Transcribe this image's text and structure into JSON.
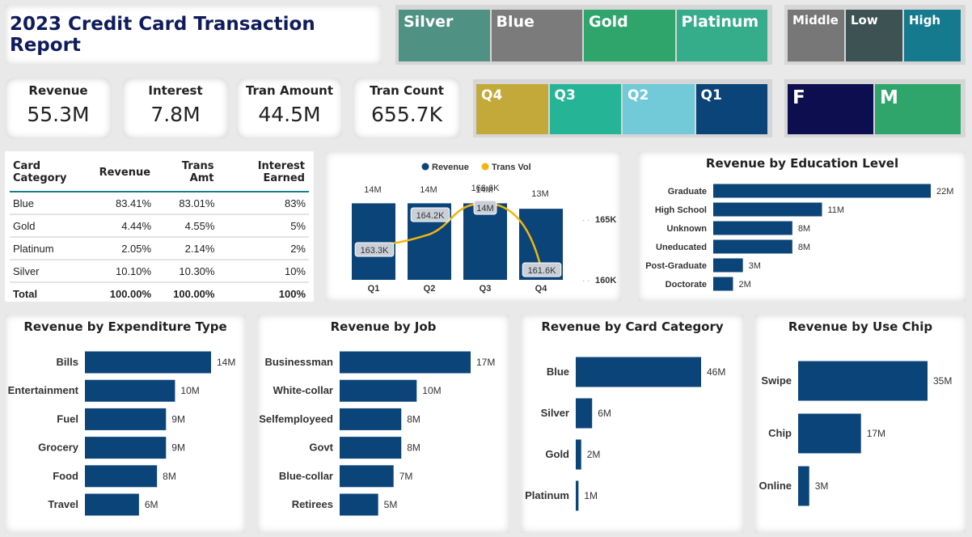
{
  "title": "2023 Credit Card Transaction Report",
  "slicers": {
    "card": [
      {
        "label": "Silver",
        "color": "#4f9283"
      },
      {
        "label": "Blue",
        "color": "#7b7b7b"
      },
      {
        "label": "Gold",
        "color": "#2fa56c"
      },
      {
        "label": "Platinum",
        "color": "#35ad8a"
      }
    ],
    "income": [
      {
        "label": "Middle",
        "color": "#777777"
      },
      {
        "label": "Low",
        "color": "#3d5252"
      },
      {
        "label": "High",
        "color": "#167a8e"
      }
    ],
    "quarter": [
      {
        "label": "Q4",
        "color": "#c2a93a"
      },
      {
        "label": "Q3",
        "color": "#26b496"
      },
      {
        "label": "Q2",
        "color": "#72c9d8"
      },
      {
        "label": "Q1",
        "color": "#0b4478"
      }
    ],
    "gender": [
      {
        "label": "F",
        "color": "#0c0e4f"
      },
      {
        "label": "M",
        "color": "#2fa56c"
      }
    ]
  },
  "kpis": [
    {
      "label": "Revenue",
      "value": "55.3M"
    },
    {
      "label": "Interest",
      "value": "7.8M"
    },
    {
      "label": "Tran Amount",
      "value": "44.5M"
    },
    {
      "label": "Tran Count",
      "value": "655.7K"
    }
  ],
  "table": {
    "headers": [
      "Card Category",
      "Revenue",
      "Trans Amt",
      "Interest Earned"
    ],
    "rows": [
      [
        "Blue",
        "83.41%",
        "83.01%",
        "83%"
      ],
      [
        "Gold",
        "4.44%",
        "4.55%",
        "5%"
      ],
      [
        "Platinum",
        "2.05%",
        "2.14%",
        "2%"
      ],
      [
        "Silver",
        "10.10%",
        "10.30%",
        "10%"
      ]
    ],
    "total": [
      "Total",
      "100.00%",
      "100.00%",
      "100%"
    ]
  },
  "colors": {
    "bar": "#0b4478",
    "line": "#f2b50f"
  },
  "chart_data": [
    {
      "type": "bar",
      "id": "combo",
      "legend": [
        "Revenue",
        "Trans Vol"
      ],
      "categories": [
        "Q1",
        "Q2",
        "Q3",
        "Q4"
      ],
      "series": [
        {
          "name": "Revenue",
          "values": [
            14,
            14,
            14,
            13
          ],
          "labels": [
            "14M",
            "14M",
            "14M",
            "13M"
          ]
        },
        {
          "name": "Trans Vol",
          "values": [
            163.3,
            164.2,
            166.6,
            161.6
          ],
          "labels": [
            "163.3K",
            "164.2K",
            "166.6K",
            "161.6K"
          ]
        }
      ],
      "y2_ticks": [
        "165K",
        "160K"
      ]
    },
    {
      "type": "bar",
      "id": "education",
      "title": "Revenue by Education Level",
      "categories": [
        "Graduate",
        "High School",
        "Unknown",
        "Uneducated",
        "Post-Graduate",
        "Doctorate"
      ],
      "values": [
        22,
        11,
        8,
        8,
        3,
        2
      ],
      "labels": [
        "22M",
        "11M",
        "8M",
        "8M",
        "3M",
        "2M"
      ]
    },
    {
      "type": "bar",
      "id": "expenditure",
      "title": "Revenue by Expenditure Type",
      "categories": [
        "Bills",
        "Entertainment",
        "Fuel",
        "Grocery",
        "Food",
        "Travel"
      ],
      "values": [
        14,
        10,
        9,
        9,
        8,
        6
      ],
      "labels": [
        "14M",
        "10M",
        "9M",
        "9M",
        "8M",
        "6M"
      ]
    },
    {
      "type": "bar",
      "id": "job",
      "title": "Revenue by Job",
      "categories": [
        "Businessman",
        "White-collar",
        "Selfemployeed",
        "Govt",
        "Blue-collar",
        "Retirees"
      ],
      "values": [
        17,
        10,
        8,
        8,
        7,
        5
      ],
      "labels": [
        "17M",
        "10M",
        "8M",
        "8M",
        "7M",
        "5M"
      ]
    },
    {
      "type": "bar",
      "id": "cardcat",
      "title": "Revenue by Card Category",
      "categories": [
        "Blue",
        "Silver",
        "Gold",
        "Platinum"
      ],
      "values": [
        46,
        6,
        2,
        1
      ],
      "labels": [
        "46M",
        "6M",
        "2M",
        "1M"
      ]
    },
    {
      "type": "bar",
      "id": "chip",
      "title": "Revenue by Use Chip",
      "categories": [
        "Swipe",
        "Chip",
        "Online"
      ],
      "values": [
        35,
        17,
        3
      ],
      "labels": [
        "35M",
        "17M",
        "3M"
      ]
    }
  ]
}
